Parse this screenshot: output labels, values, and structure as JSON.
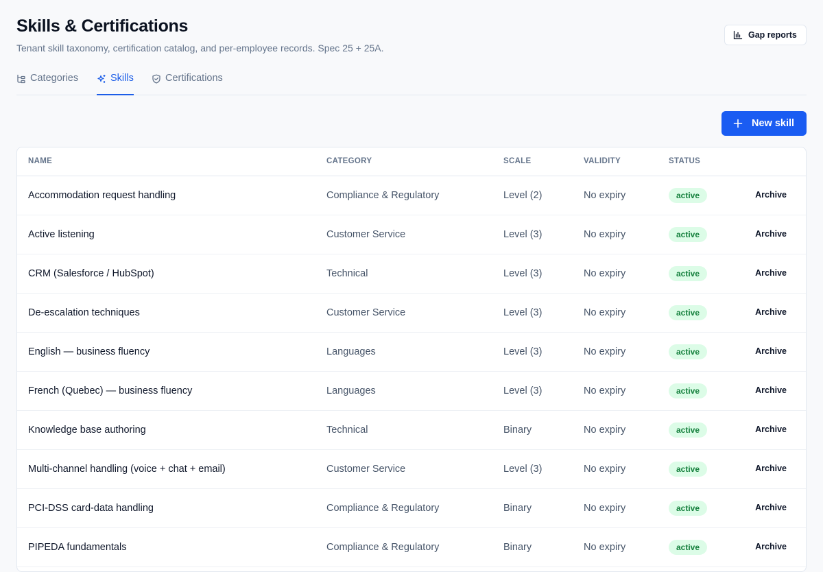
{
  "header": {
    "title": "Skills & Certifications",
    "subtitle": "Tenant skill taxonomy, certification catalog, and per-employee records. Spec 25 + 25A.",
    "gap_reports_label": "Gap reports"
  },
  "tabs": [
    {
      "label": "Categories",
      "icon": "taxonomy-icon"
    },
    {
      "label": "Skills",
      "icon": "sparkles-icon",
      "active": true
    },
    {
      "label": "Certifications",
      "icon": "shield-check-icon"
    }
  ],
  "toolbar": {
    "new_skill_label": "New skill",
    "icon": "plus-icon"
  },
  "table": {
    "columns": [
      "NAME",
      "CATEGORY",
      "SCALE",
      "VALIDITY",
      "STATUS"
    ],
    "action_label": "Archive",
    "rows": [
      {
        "name": "Accommodation request handling",
        "category": "Compliance & Regulatory",
        "scale": "Level (2)",
        "validity": "No expiry",
        "status": "active"
      },
      {
        "name": "Active listening",
        "category": "Customer Service",
        "scale": "Level (3)",
        "validity": "No expiry",
        "status": "active"
      },
      {
        "name": "CRM (Salesforce / HubSpot)",
        "category": "Technical",
        "scale": "Level (3)",
        "validity": "No expiry",
        "status": "active"
      },
      {
        "name": "De-escalation techniques",
        "category": "Customer Service",
        "scale": "Level (3)",
        "validity": "No expiry",
        "status": "active"
      },
      {
        "name": "English — business fluency",
        "category": "Languages",
        "scale": "Level (3)",
        "validity": "No expiry",
        "status": "active"
      },
      {
        "name": "French (Quebec) — business fluency",
        "category": "Languages",
        "scale": "Level (3)",
        "validity": "No expiry",
        "status": "active"
      },
      {
        "name": "Knowledge base authoring",
        "category": "Technical",
        "scale": "Binary",
        "validity": "No expiry",
        "status": "active"
      },
      {
        "name": "Multi-channel handling (voice + chat + email)",
        "category": "Customer Service",
        "scale": "Level (3)",
        "validity": "No expiry",
        "status": "active"
      },
      {
        "name": "PCI-DSS card-data handling",
        "category": "Compliance & Regulatory",
        "scale": "Binary",
        "validity": "No expiry",
        "status": "active"
      },
      {
        "name": "PIPEDA fundamentals",
        "category": "Compliance & Regulatory",
        "scale": "Binary",
        "validity": "No expiry",
        "status": "active"
      }
    ]
  },
  "colors": {
    "accent": "#1a5cf2",
    "badge_bg": "#dcfce7",
    "badge_text": "#15803d"
  }
}
